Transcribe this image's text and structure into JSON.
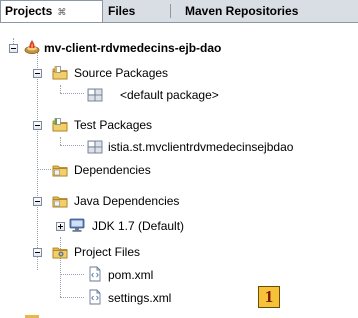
{
  "tabs": {
    "projects": "Projects",
    "projects_close": "⌘",
    "files": "Files",
    "maven": "Maven Repositories"
  },
  "tree": {
    "project": "mv-client-rdvmedecins-ejb-dao",
    "source_packages": "Source Packages",
    "default_package": "<default package>",
    "test_packages": "Test Packages",
    "test_package_item": "istia.st.mvclientrdvmedecinsejbdao",
    "dependencies": "Dependencies",
    "java_dependencies": "Java Dependencies",
    "jdk": "JDK 1.7 (Default)",
    "project_files": "Project Files",
    "pom": "pom.xml",
    "settings": "settings.xml"
  },
  "callout": "1",
  "icons": {
    "project": "maven-project-icon",
    "source_packages": "source-packages-icon",
    "package": "package-icon",
    "test_packages": "test-packages-icon",
    "dependencies": "dependencies-folder-icon",
    "java_dependencies": "java-dependencies-icon",
    "jdk": "jdk-library-icon",
    "project_files": "project-files-icon",
    "xml_file": "xml-file-icon"
  },
  "colors": {
    "tab_bar": "#d9dde4",
    "folder": "#e8b84a",
    "callout_bg": "#f5c23a",
    "callout_text": "#7a1a00"
  }
}
